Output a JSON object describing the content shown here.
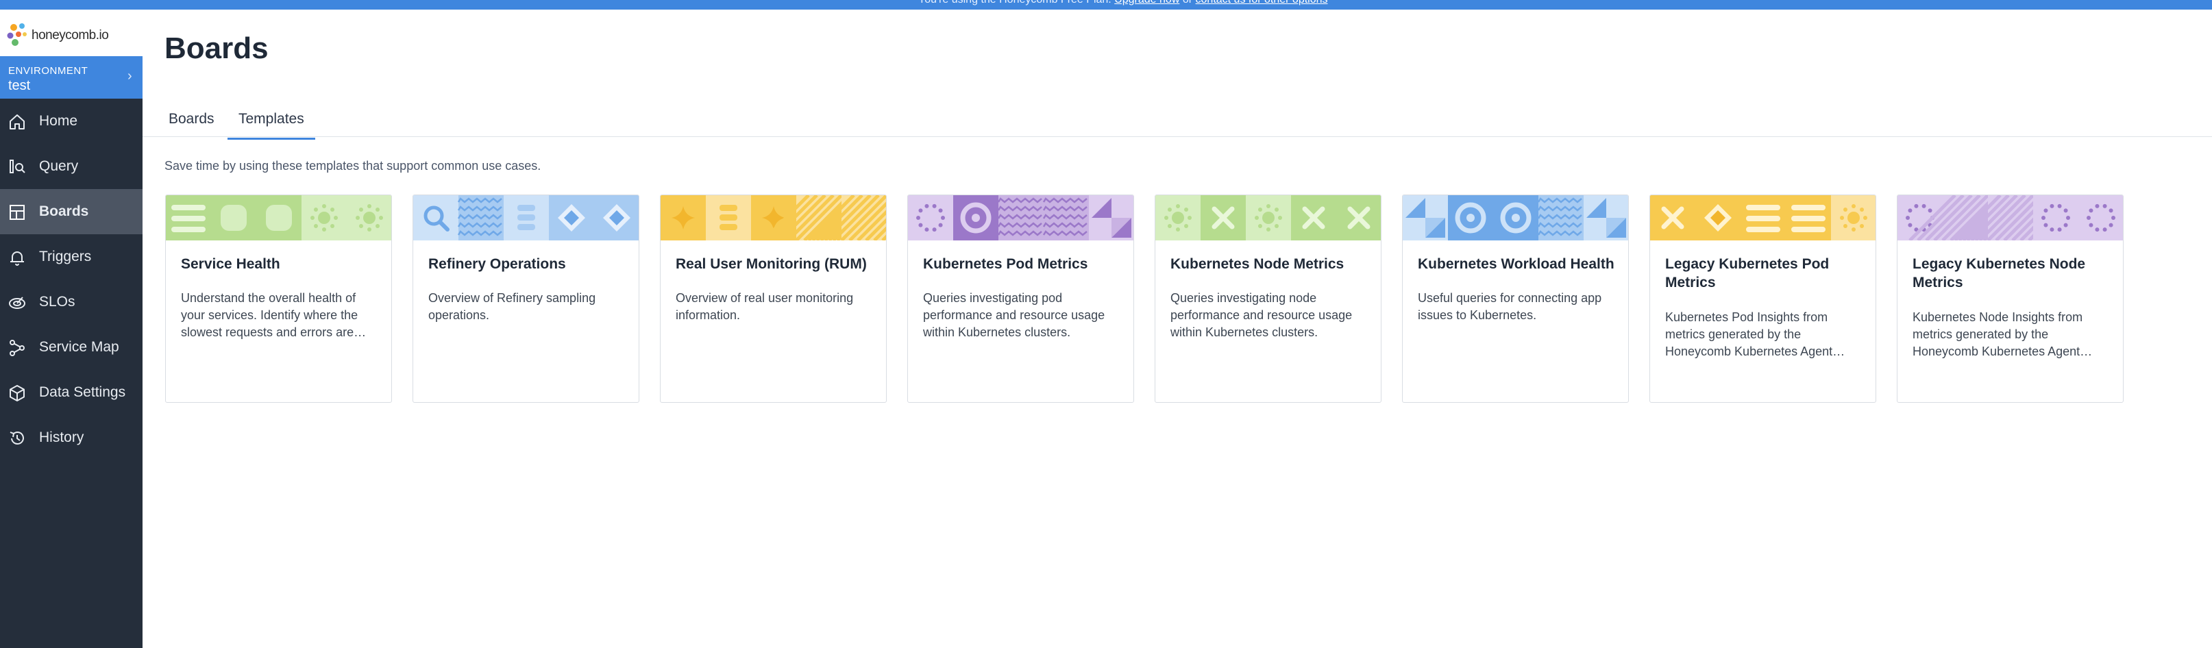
{
  "banner": {
    "text": "You're using the Honeycomb Free Plan.",
    "link1": "Upgrade now",
    "sep": "or",
    "link2": "contact us for other options"
  },
  "app": {
    "logo_text": "honeycomb.io"
  },
  "environment": {
    "label": "ENVIRONMENT",
    "value": "test"
  },
  "nav": [
    {
      "label": "Home",
      "icon": "home-icon"
    },
    {
      "label": "Query",
      "icon": "query-icon"
    },
    {
      "label": "Boards",
      "icon": "boards-icon",
      "active": true
    },
    {
      "label": "Triggers",
      "icon": "bell-icon"
    },
    {
      "label": "SLOs",
      "icon": "slo-icon"
    },
    {
      "label": "Service Map",
      "icon": "service-map-icon"
    },
    {
      "label": "Data Settings",
      "icon": "cube-icon"
    },
    {
      "label": "History",
      "icon": "history-icon"
    }
  ],
  "page": {
    "title": "Boards",
    "tabs": [
      {
        "label": "Boards"
      },
      {
        "label": "Templates",
        "active": true
      }
    ],
    "intro": "Save time by using these templates that support common use cases."
  },
  "colors": {
    "accent": "#3f86de",
    "sidebar_bg": "#252e3b",
    "green": "#b6dc8e",
    "blue": "#a7cbf2",
    "yellow": "#f7ca4f",
    "purple": "#c9b2e3"
  },
  "templates": [
    {
      "title": "Service Health",
      "description": "Understand the overall health of your services. Identify where the slowest requests and errors are…",
      "theme": "green"
    },
    {
      "title": "Refinery Operations",
      "description": "Overview of Refinery sampling operations.",
      "theme": "blue"
    },
    {
      "title": "Real User Monitoring (RUM)",
      "description": "Overview of real user monitoring information.",
      "theme": "yellow"
    },
    {
      "title": "Kubernetes Pod Metrics",
      "description": "Queries investigating pod performance and resource usage within Kubernetes clusters.",
      "theme": "purple"
    },
    {
      "title": "Kubernetes Node Metrics",
      "description": "Queries investigating node performance and resource usage within Kubernetes clusters.",
      "theme": "green"
    },
    {
      "title": "Kubernetes Workload Health",
      "description": "Useful queries for connecting app issues to Kubernetes.",
      "theme": "blue"
    },
    {
      "title": "Legacy Kubernetes Pod Metrics",
      "description": "Kubernetes Pod Insights from metrics generated by the Honeycomb Kubernetes Agent…",
      "theme": "yellow"
    },
    {
      "title": "Legacy Kubernetes Node Metrics",
      "description": "Kubernetes Node Insights from metrics generated by the Honeycomb Kubernetes Agent…",
      "theme": "purple"
    }
  ]
}
